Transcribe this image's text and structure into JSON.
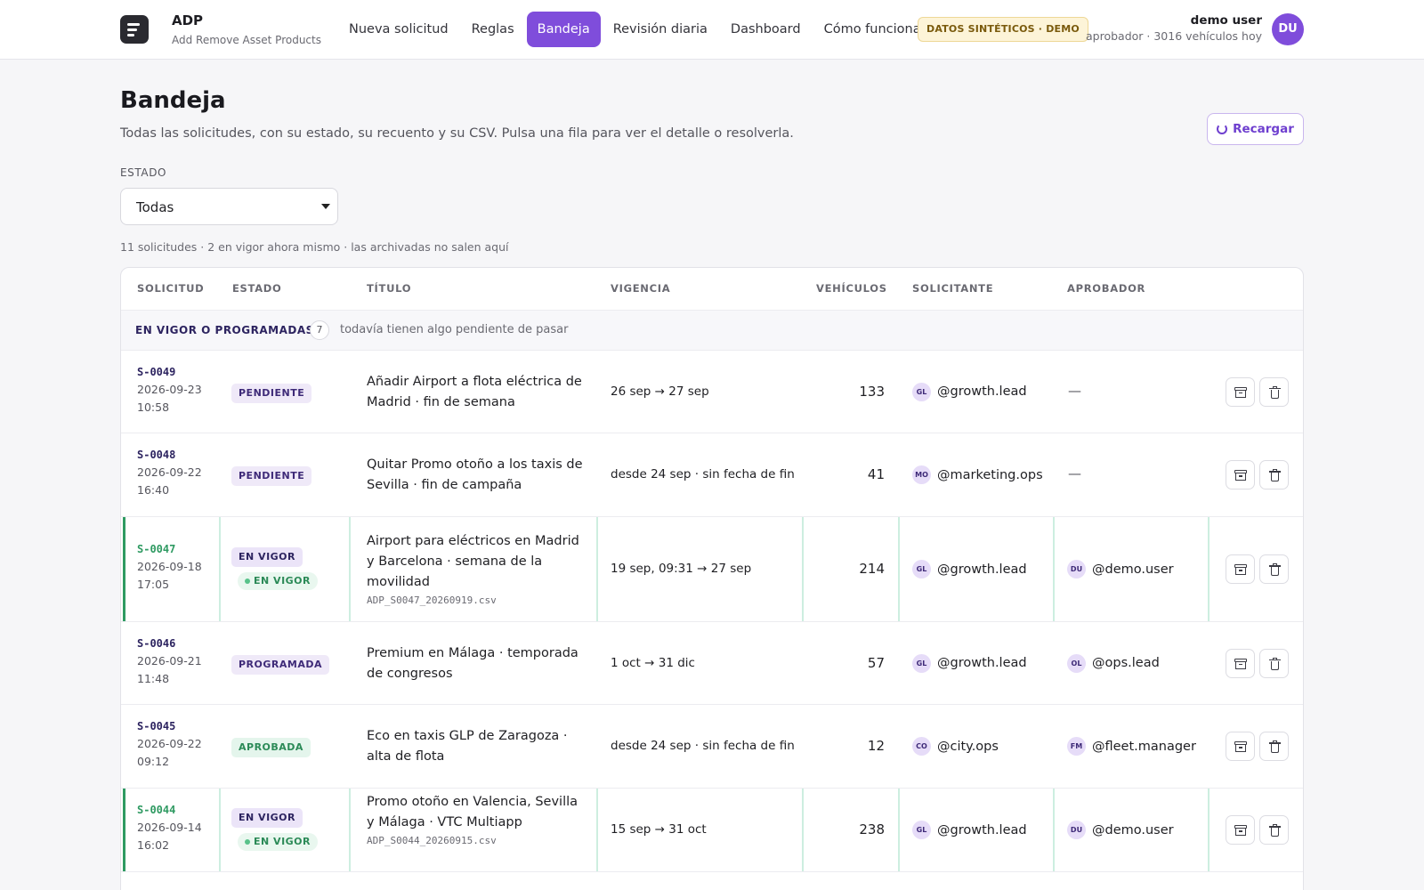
{
  "app": {
    "name": "ADP",
    "subtitle": "Add Remove Asset Products",
    "logo_icon": "menu-lines-icon"
  },
  "nav": {
    "items": [
      {
        "label": "Nueva solicitud"
      },
      {
        "label": "Reglas"
      },
      {
        "label": "Bandeja",
        "active": true
      },
      {
        "label": "Revisión diaria"
      },
      {
        "label": "Dashboard"
      },
      {
        "label": "Cómo funciona"
      }
    ],
    "demo_badge": "DATOS SINTÉTICOS · DEMO"
  },
  "user": {
    "name": "demo user",
    "role": "aprobador · 3016 vehículos hoy",
    "initials": "DU"
  },
  "page": {
    "title": "Bandeja",
    "description": "Todas las solicitudes, con su estado, su recuento y su CSV. Pulsa una fila para ver el detalle o resolverla.",
    "reload_label": "Recargar"
  },
  "filter": {
    "label": "ESTADO",
    "selected": "Todas"
  },
  "summary": "11 solicitudes · 2 en vigor ahora mismo · las archivadas no salen aquí",
  "table": {
    "headers": {
      "solicitud": "SOLICITUD",
      "estado": "ESTADO",
      "titulo": "TÍTULO",
      "vigencia": "VIGENCIA",
      "vehiculos": "VEHÍCULOS",
      "solicitante": "SOLICITANTE",
      "aprobador": "APROBADOR"
    },
    "group": {
      "title": "EN VIGOR O PROGRAMADAS",
      "count": "7",
      "note": "todavía tienen algo pendiente de pasar"
    },
    "rows": [
      {
        "id": "S-0049",
        "date": "2026-09-23",
        "time": "10:58",
        "status": "PENDIENTE",
        "live": "",
        "title": "Añadir Airport a flota eléctrica de Madrid · fin de semana",
        "csv": "",
        "vigencia": "26 sep → 27 sep",
        "vehiculos": "133",
        "req_initials": "GL",
        "requester": "@growth.lead",
        "appr_initials": "",
        "approver": "—"
      },
      {
        "id": "S-0048",
        "date": "2026-09-22",
        "time": "16:40",
        "status": "PENDIENTE",
        "live": "",
        "title": "Quitar Promo otoño a los taxis de Sevilla · fin de campaña",
        "csv": "",
        "vigencia": "desde 24 sep · sin fecha de fin",
        "vehiculos": "41",
        "req_initials": "MO",
        "requester": "@marketing.ops",
        "appr_initials": "",
        "approver": "—"
      },
      {
        "id": "S-0047",
        "date": "2026-09-18",
        "time": "17:05",
        "status": "EN VIGOR",
        "live": "EN VIGOR",
        "title": "Airport para eléctricos en Madrid y Barcelona · semana de la movilidad",
        "csv": "ADP_S0047_20260919.csv",
        "vigencia": "19 sep, 09:31 → 27 sep",
        "vehiculos": "214",
        "req_initials": "GL",
        "requester": "@growth.lead",
        "appr_initials": "DU",
        "approver": "@demo.user"
      },
      {
        "id": "S-0046",
        "date": "2026-09-21",
        "time": "11:48",
        "status": "PROGRAMADA",
        "live": "",
        "title": "Premium en Málaga · temporada de congresos",
        "csv": "",
        "vigencia": "1 oct → 31 dic",
        "vehiculos": "57",
        "req_initials": "GL",
        "requester": "@growth.lead",
        "appr_initials": "OL",
        "approver": "@ops.lead"
      },
      {
        "id": "S-0045",
        "date": "2026-09-22",
        "time": "09:12",
        "status": "APROBADA",
        "live": "",
        "title": "Eco en taxis GLP de Zaragoza · alta de flota",
        "csv": "",
        "vigencia": "desde 24 sep · sin fecha de fin",
        "vehiculos": "12",
        "req_initials": "CO",
        "requester": "@city.ops",
        "appr_initials": "FM",
        "approver": "@fleet.manager"
      },
      {
        "id": "S-0044",
        "date": "2026-09-14",
        "time": "16:02",
        "status": "EN VIGOR",
        "live": "EN VIGOR",
        "title": "Promo otoño en Valencia, Sevilla y Málaga · VTC Multiapp",
        "csv": "ADP_S0044_20260915.csv",
        "vigencia": "15 sep → 31 oct",
        "vehiculos": "238",
        "req_initials": "GL",
        "requester": "@growth.lead",
        "appr_initials": "DU",
        "approver": "@demo.user"
      }
    ]
  },
  "colors": {
    "accent": "#7f4ddb",
    "live_green": "#2f9a62",
    "demo_badge_bg": "#fdf4d8"
  }
}
